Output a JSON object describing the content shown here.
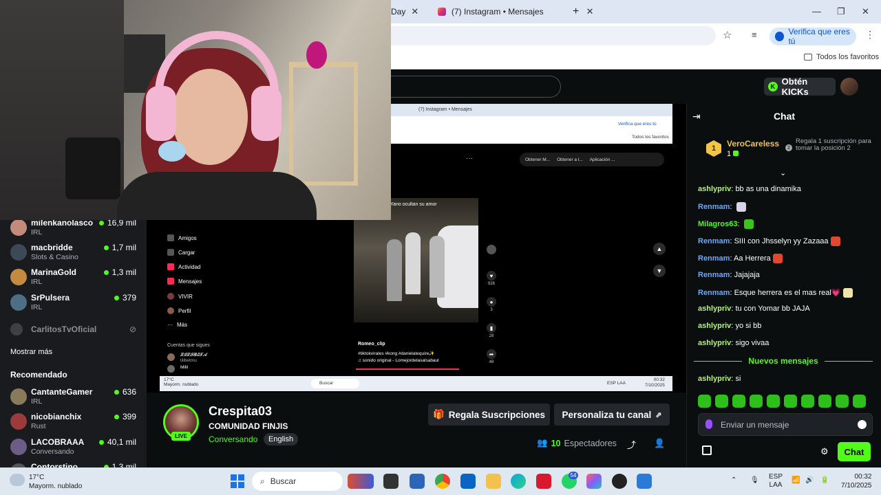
{
  "browser": {
    "tabs": [
      {
        "label": "Day"
      },
      {
        "label": "(7) Instagram • Mensajes"
      }
    ],
    "new_tab": "+",
    "verify_label": "Verifica que eres tú",
    "bookmarks_all": "Todos los favoritos"
  },
  "kick": {
    "kicks_button": "Obtén KICKs"
  },
  "sidebar": {
    "channels": [
      {
        "name": "milenkanolasco",
        "category": "IRL",
        "viewers": "16,9 mil",
        "color": "#c58b7a"
      },
      {
        "name": "macbridde",
        "category": "Slots & Casino",
        "viewers": "1,7 mil",
        "color": "#3c4a57"
      },
      {
        "name": "MarinaGold",
        "category": "IRL",
        "viewers": "1,3 mil",
        "color": "#c48a3f"
      },
      {
        "name": "SrPulsera",
        "category": "IRL",
        "viewers": "379",
        "color": "#4c6f86"
      }
    ],
    "offline_channel": "CarlitosTvOficial",
    "show_more": "Mostrar más",
    "recommended_title": "Recomendado",
    "recommended": [
      {
        "name": "CantanteGamer",
        "category": "IRL",
        "viewers": "636",
        "color": "#8a7a5c"
      },
      {
        "name": "nicobianchix",
        "category": "Rust",
        "viewers": "399",
        "color": "#9c3b3b"
      },
      {
        "name": "LACOBRAAA",
        "category": "Conversando",
        "viewers": "40,1 mil",
        "color": "#6b5d86"
      },
      {
        "name": "Contorstino",
        "category": "",
        "viewers": "1,3 mil",
        "color": "#555"
      }
    ]
  },
  "stream_screen": {
    "inner_tab": "(7) Instagram • Mensajes",
    "inner_verify": "Verifica que eres tú",
    "inner_favorites": "Todos los favoritos",
    "inner_ext_items": [
      "Obtener M...",
      "Obtener a l...",
      "Aplicación ..."
    ],
    "menu": [
      "Amigos",
      "Cargar",
      "Actividad",
      "Mensajes",
      "VIVIR",
      "Perfil",
      "Más"
    ],
    "following_title": "Cuentas que sigues",
    "following": [
      {
        "name": "𝓛𝓘𝓛𝓘𝓑𝓔𝓣𝓐",
        "handle": "lilibetmu"
      },
      {
        "name": "Milli",
        "handle": ""
      }
    ],
    "clip_caption": "Yano ocultan su amor",
    "clip_author": "Romeo_clip",
    "clip_tags": "#tiktokvirales #kong #danielatequire✨",
    "clip_sound": "♫ sonido original - Lomejordelasalsabaul",
    "likes": "926",
    "comments": "3",
    "saves": "28",
    "shares": "48",
    "inner_taskbar": {
      "weather_temp": "17°C",
      "weather_desc": "Mayorm. nublado",
      "search": "Buscar",
      "lang": "ESP LAA",
      "time": "00:32",
      "date": "7/10/2025"
    }
  },
  "channel": {
    "name": "Crespita03",
    "subtitle": "COMUNIDAD FINJIS",
    "category": "Conversando",
    "language": "English",
    "live_badge": "LIVE",
    "gift_button": "Regala Suscripciones",
    "customize_button": "Personaliza tu canal",
    "viewers_count": "10",
    "viewers_label": "Espectadores"
  },
  "chat": {
    "title": "Chat",
    "pinned_user": "VeroCareless",
    "pinned_count": "1",
    "pinned_rank_badge": "1",
    "pinned_next_badge": "2",
    "pinned_note": "Regala 1 suscripción para tomar la posición 2",
    "messages": [
      {
        "user": "ashlypriv",
        "color": "#b7f27a",
        "text": "bb as una dinamika",
        "emote": ""
      },
      {
        "user": "Renmam",
        "color": "#6aa9ff",
        "text": "",
        "emote": "#d9d2ea"
      },
      {
        "user": "Milagros63",
        "color": "#53fc18",
        "text": "",
        "emote": "#3cc41c"
      },
      {
        "user": "Renmam",
        "color": "#6aa9ff",
        "text": "SIII con Jhsselyn yy Zazaaa",
        "emote": "#e0482f"
      },
      {
        "user": "Renmam",
        "color": "#6aa9ff",
        "text": "Aa Herrera",
        "emote": "#e0482f"
      },
      {
        "user": "Renmam",
        "color": "#6aa9ff",
        "text": "Jajajaja",
        "emote": ""
      },
      {
        "user": "Renmam",
        "color": "#6aa9ff",
        "text": "Esque herrera es el mas real💗",
        "emote": "#f1e2a6"
      },
      {
        "user": "ashlypriv",
        "color": "#b7f27a",
        "text": "tu con Yomar bb JAJA",
        "emote": ""
      },
      {
        "user": "ashlypriv",
        "color": "#b7f27a",
        "text": "yo si bb",
        "emote": ""
      },
      {
        "user": "ashlypriv",
        "color": "#b7f27a",
        "text": "sigo vivaa",
        "emote": ""
      }
    ],
    "new_messages": "Nuevos mensajes",
    "after_messages": [
      {
        "user": "ashlypriv",
        "color": "#b7f27a",
        "text": "si"
      }
    ],
    "input_placeholder": "Enviar un mensaje",
    "send_button": "Chat"
  },
  "taskbar": {
    "weather_temp": "17°C",
    "weather_desc": "Mayorm. nublado",
    "search": "Buscar",
    "lang_1": "ESP",
    "lang_2": "LAA",
    "time": "00:32",
    "date": "7/10/2025",
    "whatsapp_badge": "54"
  }
}
